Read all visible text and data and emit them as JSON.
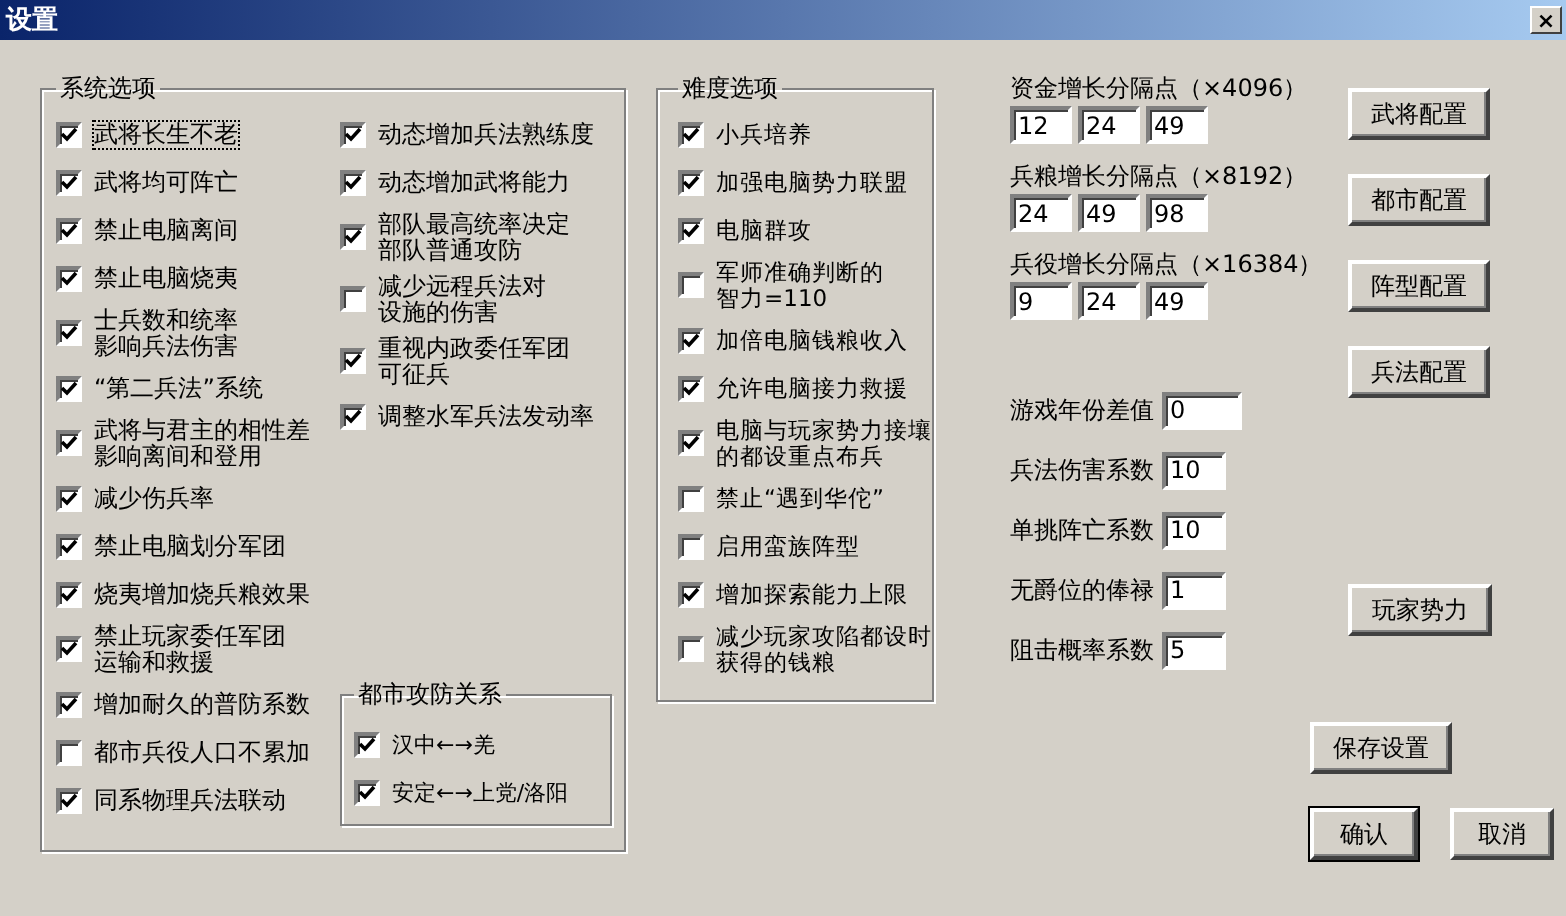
{
  "window": {
    "title": "设置",
    "close": "×"
  },
  "system_options": {
    "title": "系统选项",
    "columns": [
      {
        "items": [
          {
            "label": [
              "武将长生不老"
            ],
            "checked": true,
            "focused": true
          },
          {
            "label": [
              "武将均可阵亡"
            ],
            "checked": true,
            "focused": false
          },
          {
            "label": [
              "禁止电脑离间"
            ],
            "checked": true,
            "focused": false
          },
          {
            "label": [
              "禁止电脑烧夷"
            ],
            "checked": true,
            "focused": false
          },
          {
            "label": [
              "士兵数和统率",
              "影响兵法伤害"
            ],
            "checked": true,
            "focused": false
          },
          {
            "label": [
              "“第二兵法”系统"
            ],
            "checked": true,
            "focused": false
          },
          {
            "label": [
              "武将与君主的相性差",
              "影响离间和登用"
            ],
            "checked": true,
            "focused": false
          },
          {
            "label": [
              "减少伤兵率"
            ],
            "checked": true,
            "focused": false
          },
          {
            "label": [
              "禁止电脑划分军团"
            ],
            "checked": true,
            "focused": false
          },
          {
            "label": [
              "烧夷增加烧兵粮效果"
            ],
            "checked": true,
            "focused": false
          },
          {
            "label": [
              "禁止玩家委任军团",
              "运输和救援"
            ],
            "checked": true,
            "focused": false
          },
          {
            "label": [
              "增加耐久的普防系数"
            ],
            "checked": true,
            "focused": false
          },
          {
            "label": [
              "都市兵役人口不累加"
            ],
            "checked": false,
            "focused": false
          },
          {
            "label": [
              "同系物理兵法联动"
            ],
            "checked": true,
            "focused": false
          }
        ]
      },
      {
        "items": [
          {
            "label": [
              "动态增加兵法熟练度"
            ],
            "checked": true,
            "focused": false
          },
          {
            "label": [
              "动态增加武将能力"
            ],
            "checked": true,
            "focused": false
          },
          {
            "label": [
              "部队最高统率决定",
              "部队普通攻防"
            ],
            "checked": true,
            "focused": false
          },
          {
            "label": [
              "减少远程兵法对",
              "设施的伤害"
            ],
            "checked": false,
            "focused": false
          },
          {
            "label": [
              "重视内政委任军团",
              "可征兵"
            ],
            "checked": true,
            "focused": false
          },
          {
            "label": [
              "调整水军兵法发动率"
            ],
            "checked": true,
            "focused": false
          }
        ],
        "city_relations": {
          "title": "都市攻防关系",
          "items": [
            {
              "label": [
                "汉中←→羌"
              ],
              "checked": true,
              "focused": false
            },
            {
              "label": [
                "安定←→上党/洛阳"
              ],
              "checked": true,
              "focused": false
            }
          ]
        }
      }
    ]
  },
  "difficulty_options": {
    "title": "难度选项",
    "items": [
      {
        "label": [
          "小兵培养"
        ],
        "checked": true,
        "focused": false
      },
      {
        "label": [
          "加强电脑势力联盟"
        ],
        "checked": true,
        "focused": false
      },
      {
        "label": [
          "电脑群攻"
        ],
        "checked": true,
        "focused": false
      },
      {
        "label": [
          "军师准确判断的",
          "智力=110"
        ],
        "checked": false,
        "focused": false
      },
      {
        "label": [
          "加倍电脑钱粮收入"
        ],
        "checked": true,
        "focused": false
      },
      {
        "label": [
          "允许电脑接力救援"
        ],
        "checked": true,
        "focused": false
      },
      {
        "label": [
          "电脑与玩家势力接壤",
          "的都设重点布兵"
        ],
        "checked": true,
        "focused": false
      },
      {
        "label": [
          "禁止“遇到华佗”"
        ],
        "checked": false,
        "focused": false
      },
      {
        "label": [
          "启用蛮族阵型"
        ],
        "checked": false,
        "focused": false
      },
      {
        "label": [
          "增加探索能力上限"
        ],
        "checked": true,
        "focused": false
      },
      {
        "label": [
          "减少玩家攻陷都设时",
          "获得的钱粮"
        ],
        "checked": false,
        "focused": false
      }
    ]
  },
  "growth_breakpoints": [
    {
      "label": "资金增长分隔点（×4096）",
      "values": [
        "12",
        "24",
        "49"
      ]
    },
    {
      "label": "兵粮增长分隔点（×8192）",
      "values": [
        "24",
        "49",
        "98"
      ]
    },
    {
      "label": "兵役增长分隔点（×16384）",
      "values": [
        "9",
        "24",
        "49"
      ]
    }
  ],
  "parameters": [
    {
      "label": "游戏年份差值",
      "value": "0"
    },
    {
      "label": "兵法伤害系数",
      "value": "10"
    },
    {
      "label": "单挑阵亡系数",
      "value": "10"
    },
    {
      "label": "无爵位的俸禄",
      "value": "1"
    },
    {
      "label": "阻击概率系数",
      "value": "5"
    }
  ],
  "config_buttons": [
    "武将配置",
    "都市配置",
    "阵型配置",
    "兵法配置"
  ],
  "player_forces_button": "玩家势力",
  "save_button": "保存设置",
  "ok_button": "确认",
  "cancel_button": "取消"
}
